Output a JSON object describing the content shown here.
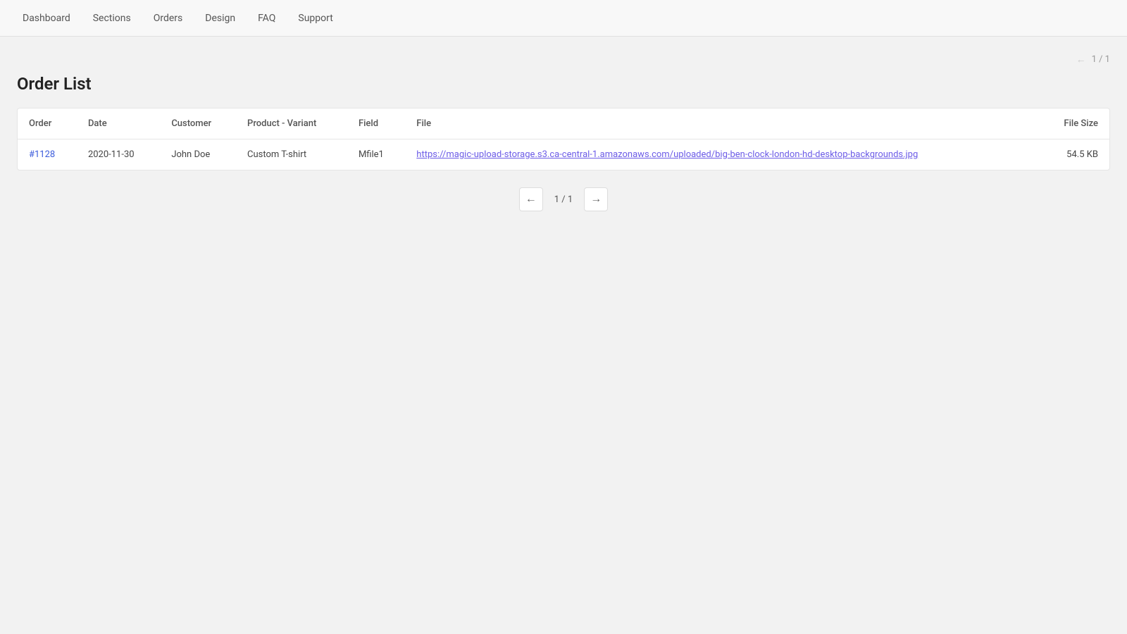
{
  "nav": {
    "items": [
      {
        "label": "Dashboard",
        "id": "dashboard"
      },
      {
        "label": "Sections",
        "id": "sections"
      },
      {
        "label": "Orders",
        "id": "orders"
      },
      {
        "label": "Design",
        "id": "design"
      },
      {
        "label": "FAQ",
        "id": "faq"
      },
      {
        "label": "Support",
        "id": "support"
      }
    ]
  },
  "top_pagination": {
    "arrow": "←",
    "info": "1 / 1"
  },
  "page": {
    "title": "Order List"
  },
  "table": {
    "columns": [
      {
        "label": "Order",
        "id": "order"
      },
      {
        "label": "Date",
        "id": "date"
      },
      {
        "label": "Customer",
        "id": "customer"
      },
      {
        "label": "Product - Variant",
        "id": "product_variant"
      },
      {
        "label": "Field",
        "id": "field"
      },
      {
        "label": "File",
        "id": "file"
      },
      {
        "label": "File Size",
        "id": "file_size"
      }
    ],
    "rows": [
      {
        "order": "#1128",
        "date": "2020-11-30",
        "customer": "John Doe",
        "product_variant": "Custom T-shirt",
        "field": "Mfile1",
        "file_url": "https://magic-upload-storage.s3.ca-central-1.amazonaws.com/uploaded/big-ben-clock-london-hd-desktop-backgrounds.jpg",
        "file_size": "54.5 KB"
      }
    ]
  },
  "bottom_pagination": {
    "prev_arrow": "←",
    "next_arrow": "→",
    "info": "1 / 1"
  }
}
